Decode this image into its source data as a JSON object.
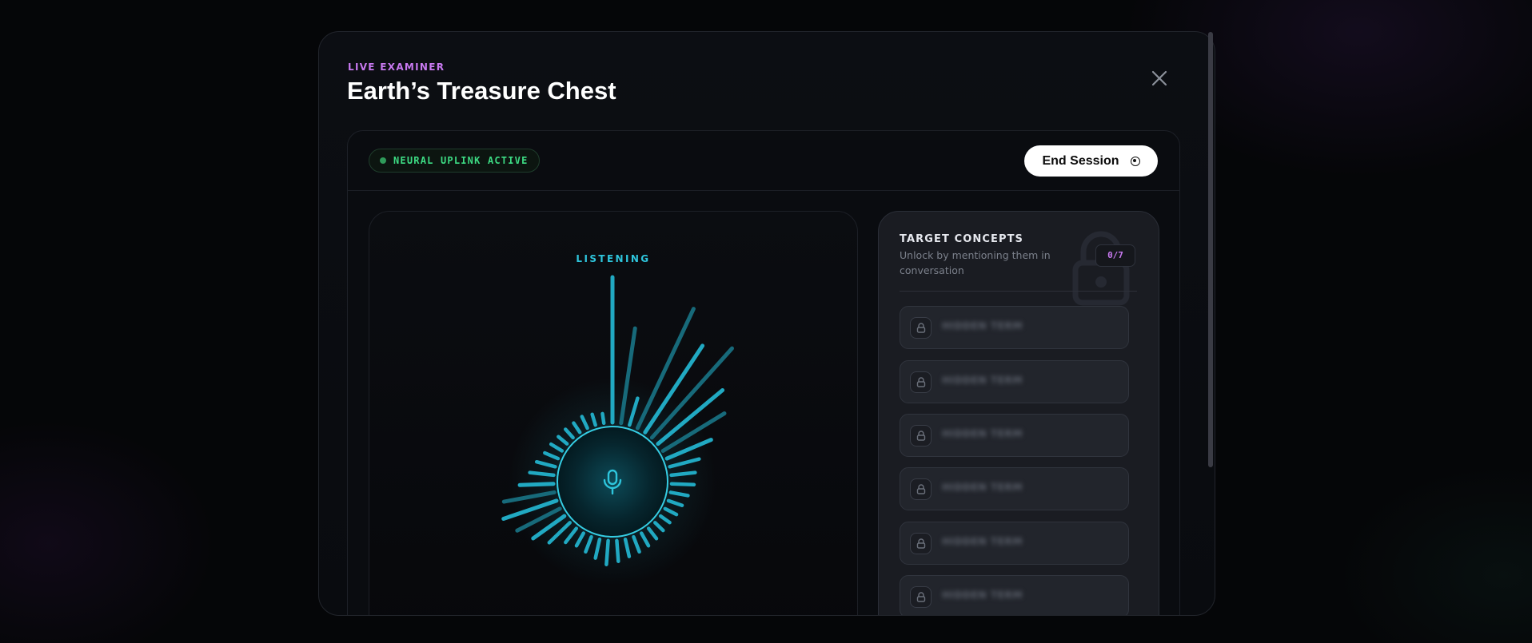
{
  "modal": {
    "eyebrow": "LIVE EXAMINER",
    "title": "Earth’s Treasure Chest",
    "close_icon": "close-icon"
  },
  "session": {
    "status": "NEURAL UPLINK ACTIVE",
    "status_color": "#3ddc84",
    "end_label": "End Session",
    "end_icon": "stop-circle-icon"
  },
  "visualizer": {
    "state": "LISTENING",
    "accent": "#2ec5dc",
    "mic_icon": "microphone-icon"
  },
  "concepts": {
    "title": "TARGET CONCEPTS",
    "subtitle": "Unlock by mentioning them in conversation",
    "count": "0/7",
    "watermark_icon": "unlocked-padlock-icon",
    "items": [
      {
        "label": "HIDDEN TERM",
        "icon": "lock-icon"
      },
      {
        "label": "HIDDEN TERM",
        "icon": "lock-icon"
      },
      {
        "label": "HIDDEN TERM",
        "icon": "lock-icon"
      },
      {
        "label": "HIDDEN TERM",
        "icon": "lock-icon"
      },
      {
        "label": "HIDDEN TERM",
        "icon": "lock-icon"
      },
      {
        "label": "HIDDEN TERM",
        "icon": "lock-icon"
      }
    ]
  }
}
